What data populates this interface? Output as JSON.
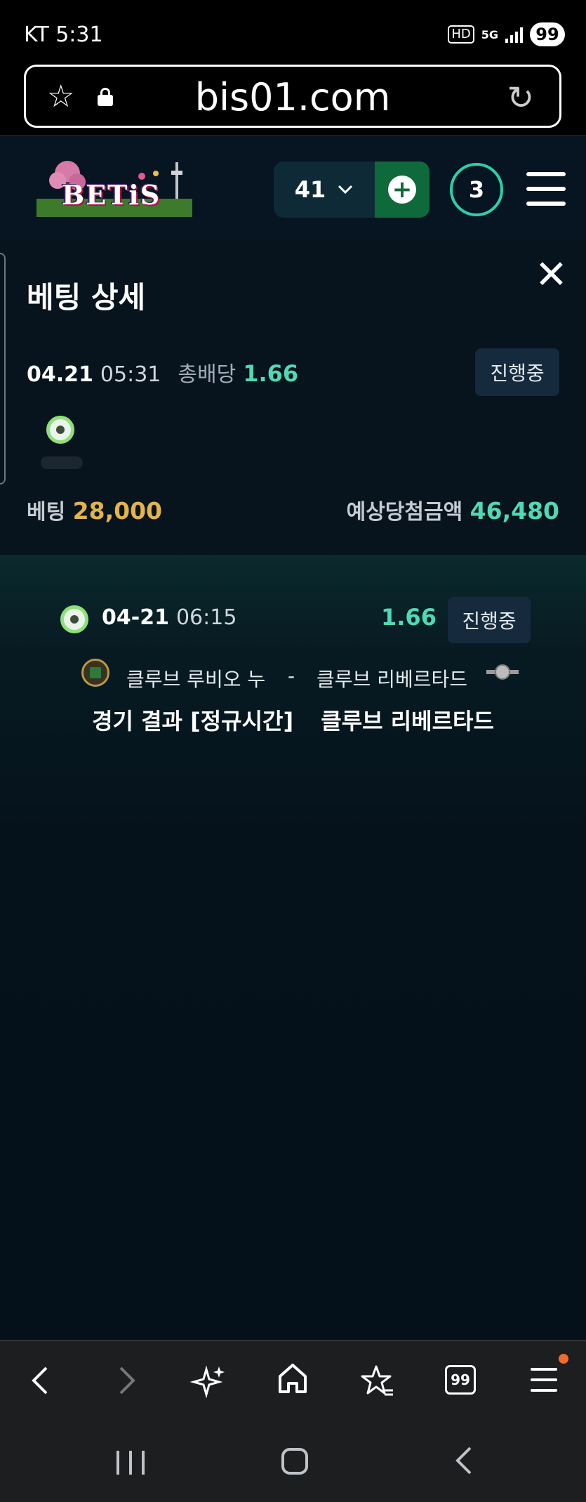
{
  "status_bar": {
    "carrier_time": "KT 5:31",
    "hd_badge": "HD",
    "network": "5G",
    "battery": "99"
  },
  "browser": {
    "url": "bis01.com",
    "star_icon": "star-outline-icon",
    "lock_icon": "lock-icon",
    "reload_icon": "reload-icon"
  },
  "header": {
    "logo_text": "BETiS",
    "count": "41",
    "badge_count": "3",
    "accent": "#2ad0a8",
    "plus_bg": "#0e6a3a"
  },
  "panel": {
    "title": "베팅 상세",
    "date": "04.21",
    "time": "05:31",
    "total_odds_label": "총배당",
    "total_odds": "1.66",
    "status": "진행중",
    "bet_label": "베팅",
    "bet_amount": "28,000",
    "expected_label": "예상당첨금액",
    "expected_amount": "46,480"
  },
  "match": {
    "date": "04-21",
    "time": "06:15",
    "odds": "1.66",
    "status": "진행중",
    "home_team": "클루브 루비오 누",
    "separator": "-",
    "away_team": "클루브 리베르타드",
    "result_label": "경기 결과 [정규시간]",
    "result_pick": "클루브 리베르타드"
  },
  "bottom_nav": {
    "tabs_count": "99",
    "items": [
      "back-icon",
      "forward-icon",
      "sparkle-icon",
      "home-icon",
      "bookmark-star-icon",
      "tabs-icon",
      "menu-icon"
    ]
  },
  "colors": {
    "odds_green": "#4fd9b5",
    "bet_gold": "#e2b44a",
    "background": "#04101a"
  }
}
